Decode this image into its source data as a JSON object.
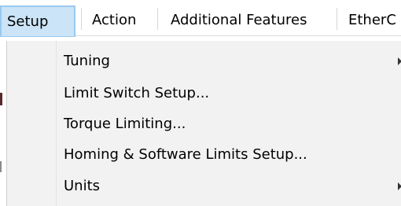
{
  "menubar": {
    "items": [
      {
        "label": "Setup",
        "active": true
      },
      {
        "label": "Action",
        "active": false
      },
      {
        "label": "Additional Features",
        "active": false
      },
      {
        "label": "EtherC",
        "active": false
      }
    ]
  },
  "dropdown": {
    "items": [
      {
        "label": "Tuning",
        "has_submenu": true
      },
      {
        "label": "Limit Switch Setup...",
        "has_submenu": false
      },
      {
        "label": "Torque Limiting...",
        "has_submenu": false
      },
      {
        "label": "Homing & Software Limits Setup...",
        "has_submenu": false
      },
      {
        "label": "Units",
        "has_submenu": true
      }
    ]
  },
  "icons": {
    "submenu": "chevron-right-icon"
  },
  "colors": {
    "active_menu_bg": "#cce4f7",
    "active_menu_border": "#99c9ef",
    "dropdown_bg": "#f2f2f2"
  }
}
